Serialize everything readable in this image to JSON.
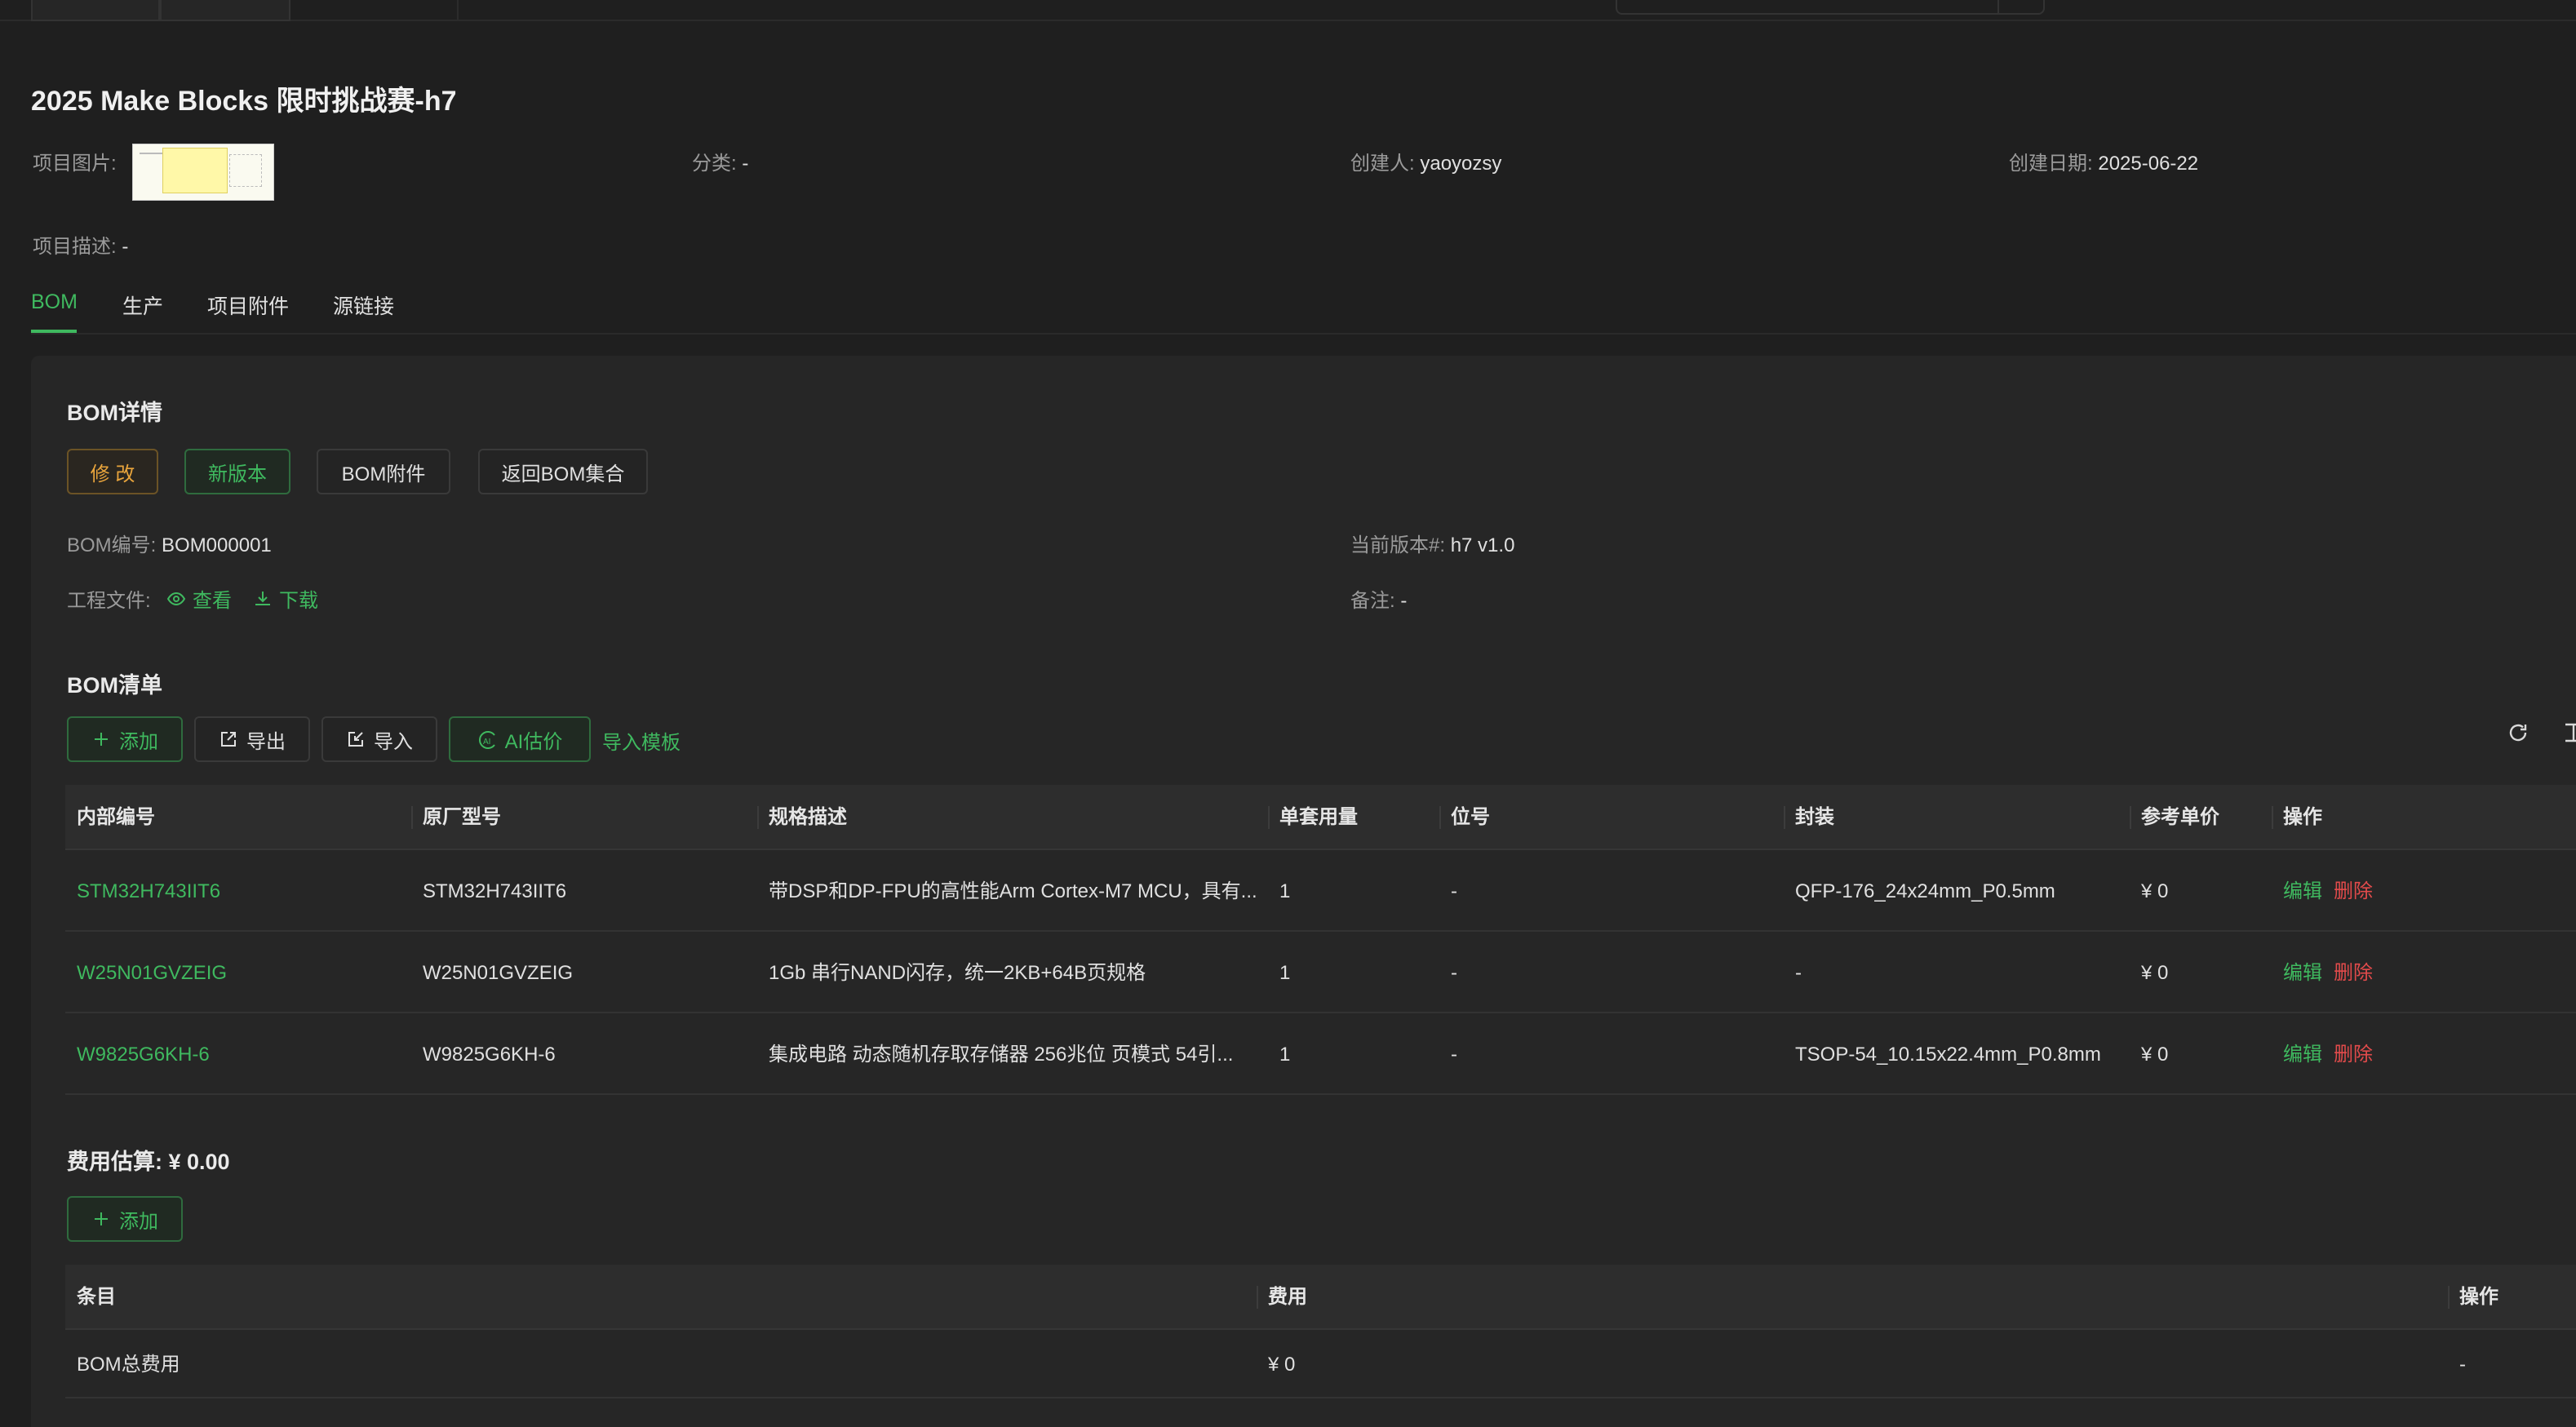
{
  "project": {
    "title": "2025 Make Blocks 限时挑战赛-h7",
    "image_label": "项目图片:",
    "category_label": "分类:",
    "category_value": "-",
    "creator_label": "创建人:",
    "creator_value": "yaoyozsy",
    "date_label": "创建日期:",
    "date_value": "2025-06-22",
    "desc_label": "项目描述:",
    "desc_value": "-"
  },
  "tabs": [
    "BOM",
    "生产",
    "项目附件",
    "源链接"
  ],
  "bom": {
    "heading": "BOM详情",
    "buttons": {
      "edit": "修 改",
      "new_version": "新版本",
      "attachments": "BOM附件",
      "back": "返回BOM集合"
    },
    "number_label": "BOM编号:",
    "number_value": "BOM000001",
    "version_label": "当前版本#:",
    "version_value": "h7 v1.0",
    "files_label": "工程文件:",
    "view_label": "查看",
    "download_label": "下载",
    "remark_label": "备注:",
    "remark_value": "-"
  },
  "bom_list": {
    "heading": "BOM清单",
    "toolbar": {
      "add": "添加",
      "export": "导出",
      "import": "导入",
      "ai": "AI估价",
      "template": "导入模板"
    },
    "columns": [
      "内部编号",
      "原厂型号",
      "规格描述",
      "单套用量",
      "位号",
      "封装",
      "参考单价",
      "操作"
    ],
    "rows": [
      {
        "id": "STM32H743IIT6",
        "mpn": "STM32H743IIT6",
        "desc": "带DSP和DP-FPU的高性能Arm Cortex-M7 MCU，具有...",
        "qty": "1",
        "ref": "-",
        "pkg": "QFP-176_24x24mm_P0.5mm",
        "price": "¥ 0",
        "edit": "编辑",
        "del": "删除"
      },
      {
        "id": "W25N01GVZEIG",
        "mpn": "W25N01GVZEIG",
        "desc": "1Gb 串行NAND闪存，统一2KB+64B页规格",
        "qty": "1",
        "ref": "-",
        "pkg": "-",
        "price": "¥ 0",
        "edit": "编辑",
        "del": "删除"
      },
      {
        "id": "W9825G6KH-6",
        "mpn": "W9825G6KH-6",
        "desc": "集成电路 动态随机存取存储器 256兆位 页模式 54引...",
        "qty": "1",
        "ref": "-",
        "pkg": "TSOP-54_10.15x22.4mm_P0.8mm",
        "price": "¥ 0",
        "edit": "编辑",
        "del": "删除"
      }
    ]
  },
  "cost": {
    "heading": "费用估算: ¥ 0.00",
    "add": "添加",
    "columns": [
      "条目",
      "费用",
      "操作"
    ],
    "rows": [
      {
        "item": "BOM总费用",
        "fee": "¥ 0",
        "op": "-"
      }
    ]
  },
  "colors": {
    "accent": "#3fb95f",
    "warning": "#e8a43c",
    "danger": "#e24b4b",
    "background": "#1f1f1f"
  },
  "icons": [
    "eye-icon",
    "download-icon",
    "plus-icon",
    "export-icon",
    "import-icon",
    "ai-icon",
    "refresh-icon",
    "column-height-icon"
  ]
}
